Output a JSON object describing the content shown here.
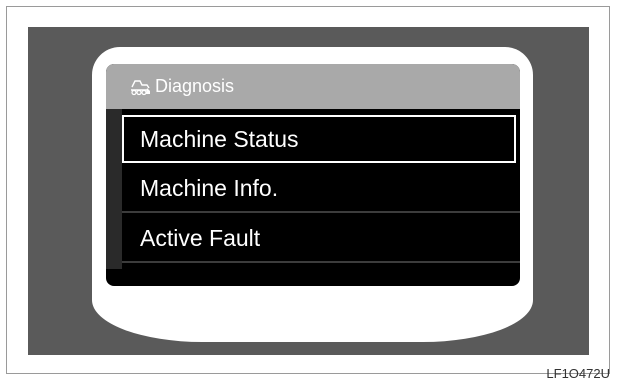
{
  "screen": {
    "header": {
      "title": "Diagnosis",
      "icon": "excavator-icon"
    },
    "menu": [
      {
        "label": "Machine Status",
        "selected": true
      },
      {
        "label": "Machine Info.",
        "selected": false
      },
      {
        "label": "Active Fault",
        "selected": false
      }
    ]
  },
  "figure_code": "LF1O472U",
  "colors": {
    "header_bg": "#a9a9a9",
    "screen_bg": "#000000",
    "housing": "#5a5a5a"
  }
}
